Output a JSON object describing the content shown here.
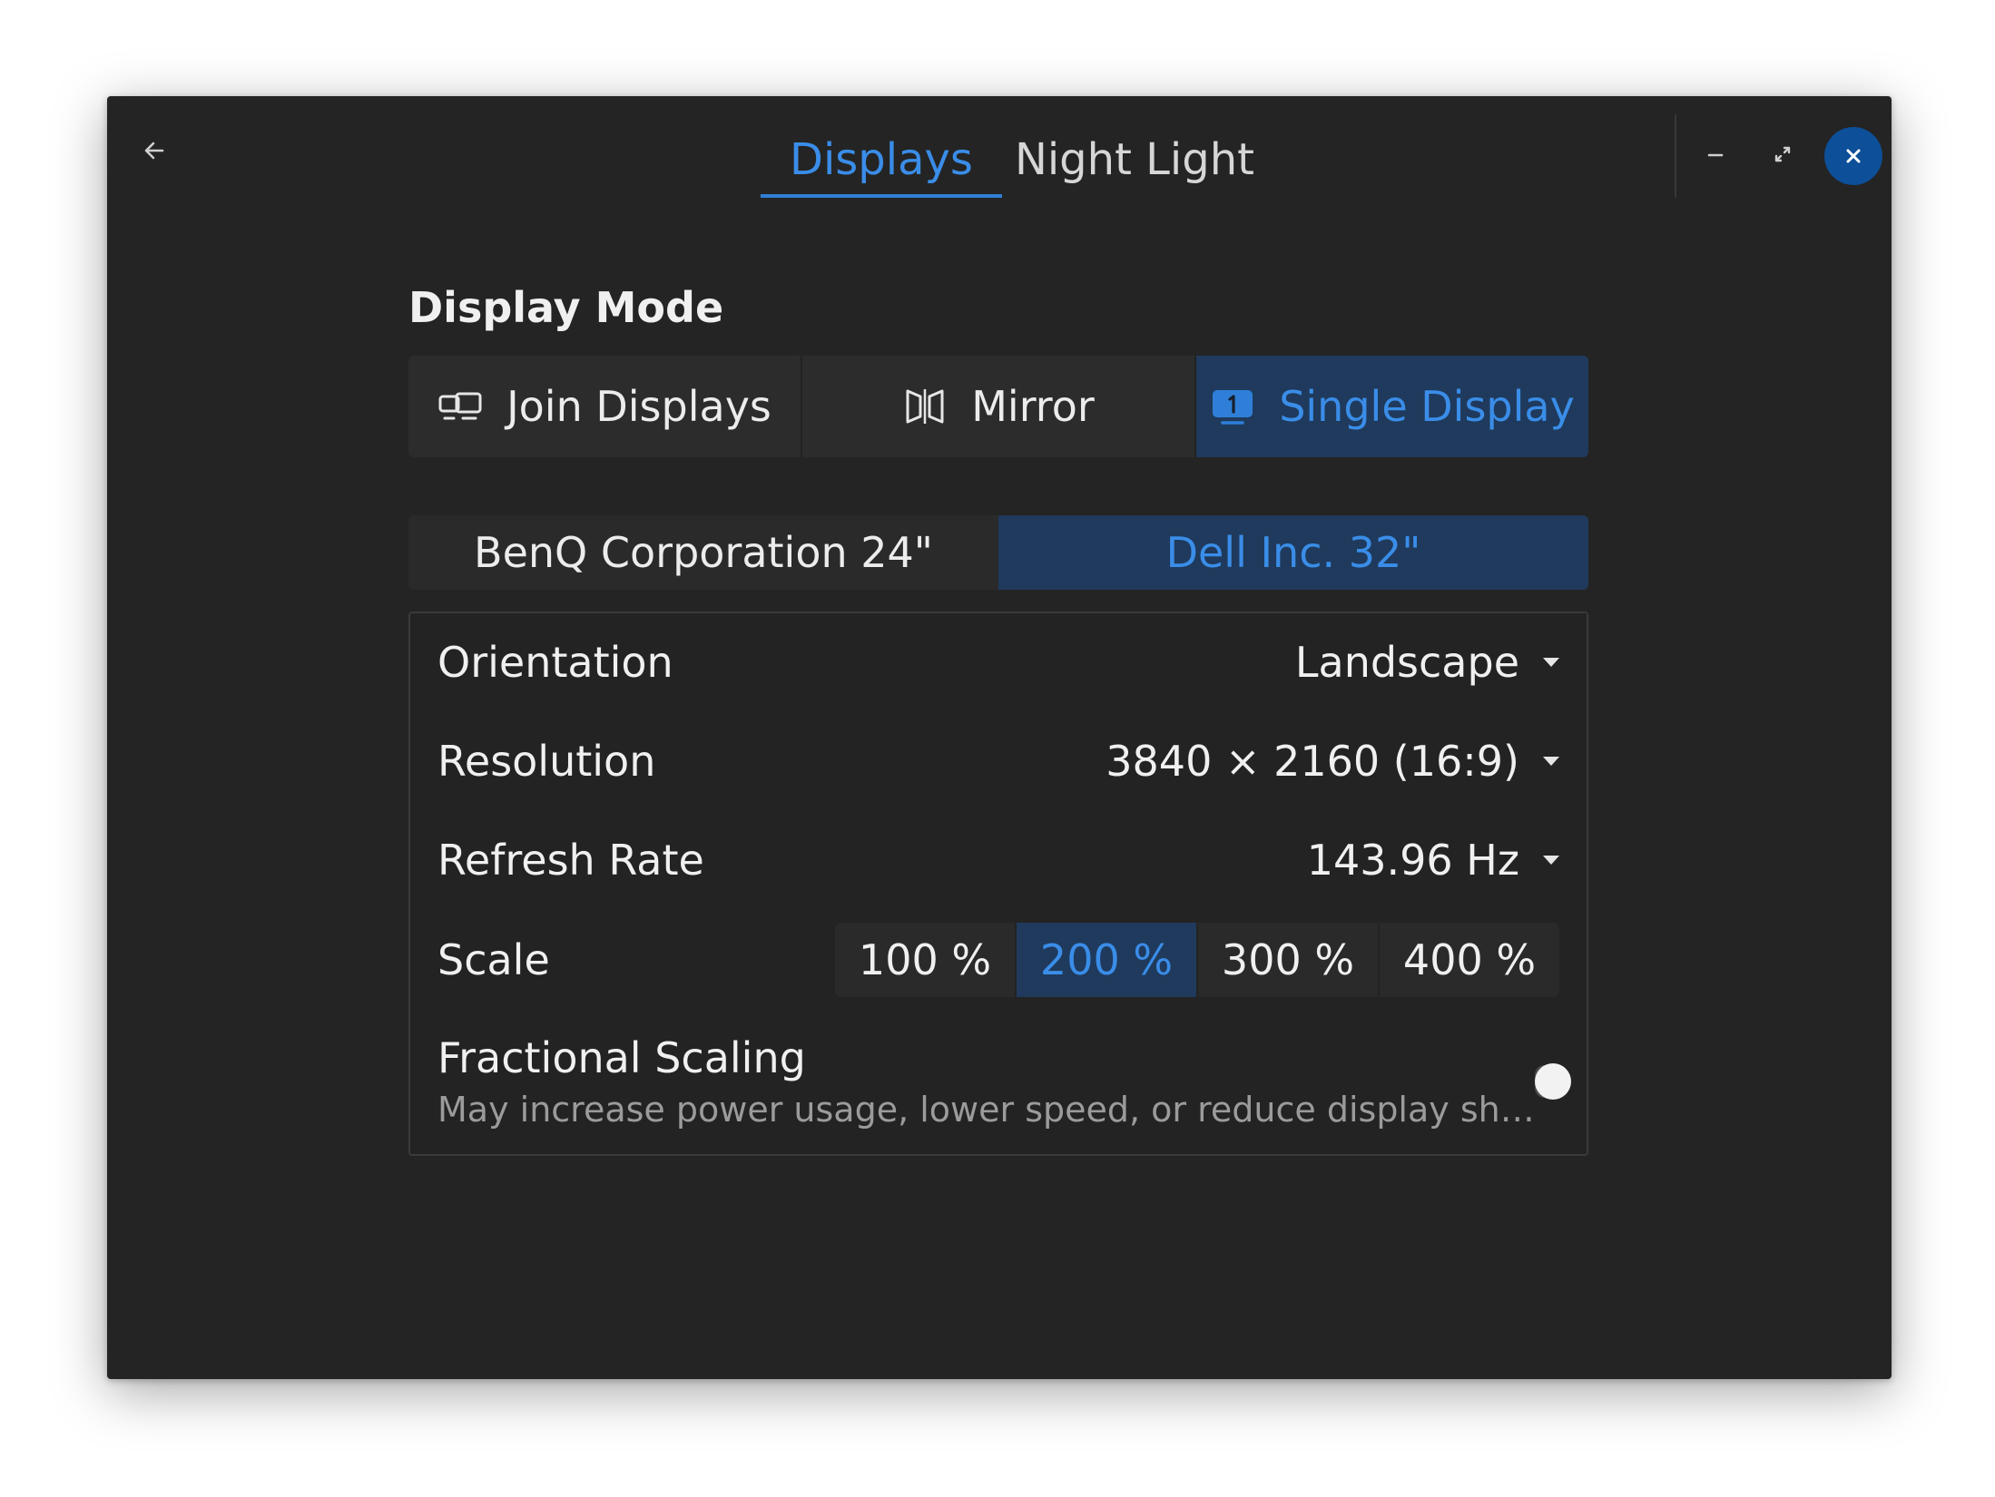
{
  "header": {
    "tabs": [
      {
        "label": "Displays",
        "active": true
      },
      {
        "label": "Night Light",
        "active": false
      }
    ]
  },
  "display_mode": {
    "title": "Display Mode",
    "options": [
      {
        "label": "Join Displays",
        "icon": "join-displays-icon",
        "active": false
      },
      {
        "label": "Mirror",
        "icon": "mirror-icon",
        "active": false
      },
      {
        "label": "Single Display",
        "icon": "single-display-icon",
        "active": true
      }
    ]
  },
  "displays": [
    {
      "label": "BenQ Corporation 24\"",
      "active": false
    },
    {
      "label": "Dell Inc. 32\"",
      "active": true
    }
  ],
  "settings": {
    "orientation": {
      "label": "Orientation",
      "value": "Landscape"
    },
    "resolution": {
      "label": "Resolution",
      "value": "3840 × 2160 (16:9)"
    },
    "refresh_rate": {
      "label": "Refresh Rate",
      "value": "143.96 Hz"
    },
    "scale": {
      "label": "Scale",
      "options": [
        "100 %",
        "200 %",
        "300 %",
        "400 %"
      ],
      "selected": "200 %"
    },
    "fractional_scaling": {
      "label": "Fractional Scaling",
      "description": "May increase power usage, lower speed, or reduce display sh…",
      "enabled": false
    }
  },
  "colors": {
    "accent": "#3a8de8",
    "close_button": "#0d4f98",
    "window_bg": "#242424"
  }
}
